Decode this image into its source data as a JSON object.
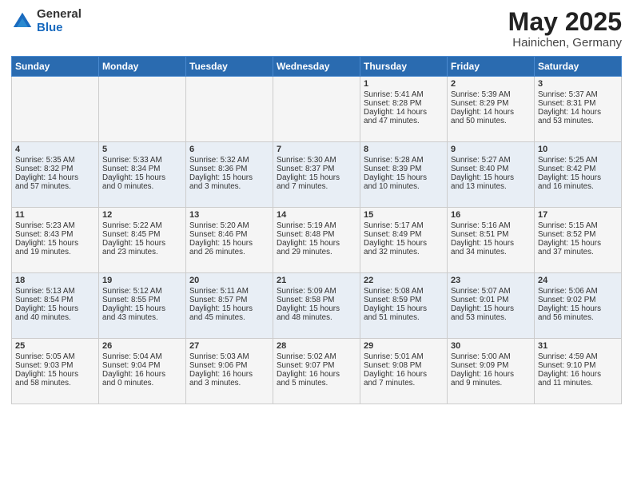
{
  "logo": {
    "general": "General",
    "blue": "Blue"
  },
  "title": "May 2025",
  "location": "Hainichen, Germany",
  "days_of_week": [
    "Sunday",
    "Monday",
    "Tuesday",
    "Wednesday",
    "Thursday",
    "Friday",
    "Saturday"
  ],
  "weeks": [
    [
      {
        "day": "",
        "content": ""
      },
      {
        "day": "",
        "content": ""
      },
      {
        "day": "",
        "content": ""
      },
      {
        "day": "",
        "content": ""
      },
      {
        "day": "1",
        "content": "Sunrise: 5:41 AM\nSunset: 8:28 PM\nDaylight: 14 hours\nand 47 minutes."
      },
      {
        "day": "2",
        "content": "Sunrise: 5:39 AM\nSunset: 8:29 PM\nDaylight: 14 hours\nand 50 minutes."
      },
      {
        "day": "3",
        "content": "Sunrise: 5:37 AM\nSunset: 8:31 PM\nDaylight: 14 hours\nand 53 minutes."
      }
    ],
    [
      {
        "day": "4",
        "content": "Sunrise: 5:35 AM\nSunset: 8:32 PM\nDaylight: 14 hours\nand 57 minutes."
      },
      {
        "day": "5",
        "content": "Sunrise: 5:33 AM\nSunset: 8:34 PM\nDaylight: 15 hours\nand 0 minutes."
      },
      {
        "day": "6",
        "content": "Sunrise: 5:32 AM\nSunset: 8:36 PM\nDaylight: 15 hours\nand 3 minutes."
      },
      {
        "day": "7",
        "content": "Sunrise: 5:30 AM\nSunset: 8:37 PM\nDaylight: 15 hours\nand 7 minutes."
      },
      {
        "day": "8",
        "content": "Sunrise: 5:28 AM\nSunset: 8:39 PM\nDaylight: 15 hours\nand 10 minutes."
      },
      {
        "day": "9",
        "content": "Sunrise: 5:27 AM\nSunset: 8:40 PM\nDaylight: 15 hours\nand 13 minutes."
      },
      {
        "day": "10",
        "content": "Sunrise: 5:25 AM\nSunset: 8:42 PM\nDaylight: 15 hours\nand 16 minutes."
      }
    ],
    [
      {
        "day": "11",
        "content": "Sunrise: 5:23 AM\nSunset: 8:43 PM\nDaylight: 15 hours\nand 19 minutes."
      },
      {
        "day": "12",
        "content": "Sunrise: 5:22 AM\nSunset: 8:45 PM\nDaylight: 15 hours\nand 23 minutes."
      },
      {
        "day": "13",
        "content": "Sunrise: 5:20 AM\nSunset: 8:46 PM\nDaylight: 15 hours\nand 26 minutes."
      },
      {
        "day": "14",
        "content": "Sunrise: 5:19 AM\nSunset: 8:48 PM\nDaylight: 15 hours\nand 29 minutes."
      },
      {
        "day": "15",
        "content": "Sunrise: 5:17 AM\nSunset: 8:49 PM\nDaylight: 15 hours\nand 32 minutes."
      },
      {
        "day": "16",
        "content": "Sunrise: 5:16 AM\nSunset: 8:51 PM\nDaylight: 15 hours\nand 34 minutes."
      },
      {
        "day": "17",
        "content": "Sunrise: 5:15 AM\nSunset: 8:52 PM\nDaylight: 15 hours\nand 37 minutes."
      }
    ],
    [
      {
        "day": "18",
        "content": "Sunrise: 5:13 AM\nSunset: 8:54 PM\nDaylight: 15 hours\nand 40 minutes."
      },
      {
        "day": "19",
        "content": "Sunrise: 5:12 AM\nSunset: 8:55 PM\nDaylight: 15 hours\nand 43 minutes."
      },
      {
        "day": "20",
        "content": "Sunrise: 5:11 AM\nSunset: 8:57 PM\nDaylight: 15 hours\nand 45 minutes."
      },
      {
        "day": "21",
        "content": "Sunrise: 5:09 AM\nSunset: 8:58 PM\nDaylight: 15 hours\nand 48 minutes."
      },
      {
        "day": "22",
        "content": "Sunrise: 5:08 AM\nSunset: 8:59 PM\nDaylight: 15 hours\nand 51 minutes."
      },
      {
        "day": "23",
        "content": "Sunrise: 5:07 AM\nSunset: 9:01 PM\nDaylight: 15 hours\nand 53 minutes."
      },
      {
        "day": "24",
        "content": "Sunrise: 5:06 AM\nSunset: 9:02 PM\nDaylight: 15 hours\nand 56 minutes."
      }
    ],
    [
      {
        "day": "25",
        "content": "Sunrise: 5:05 AM\nSunset: 9:03 PM\nDaylight: 15 hours\nand 58 minutes."
      },
      {
        "day": "26",
        "content": "Sunrise: 5:04 AM\nSunset: 9:04 PM\nDaylight: 16 hours\nand 0 minutes."
      },
      {
        "day": "27",
        "content": "Sunrise: 5:03 AM\nSunset: 9:06 PM\nDaylight: 16 hours\nand 3 minutes."
      },
      {
        "day": "28",
        "content": "Sunrise: 5:02 AM\nSunset: 9:07 PM\nDaylight: 16 hours\nand 5 minutes."
      },
      {
        "day": "29",
        "content": "Sunrise: 5:01 AM\nSunset: 9:08 PM\nDaylight: 16 hours\nand 7 minutes."
      },
      {
        "day": "30",
        "content": "Sunrise: 5:00 AM\nSunset: 9:09 PM\nDaylight: 16 hours\nand 9 minutes."
      },
      {
        "day": "31",
        "content": "Sunrise: 4:59 AM\nSunset: 9:10 PM\nDaylight: 16 hours\nand 11 minutes."
      }
    ]
  ]
}
